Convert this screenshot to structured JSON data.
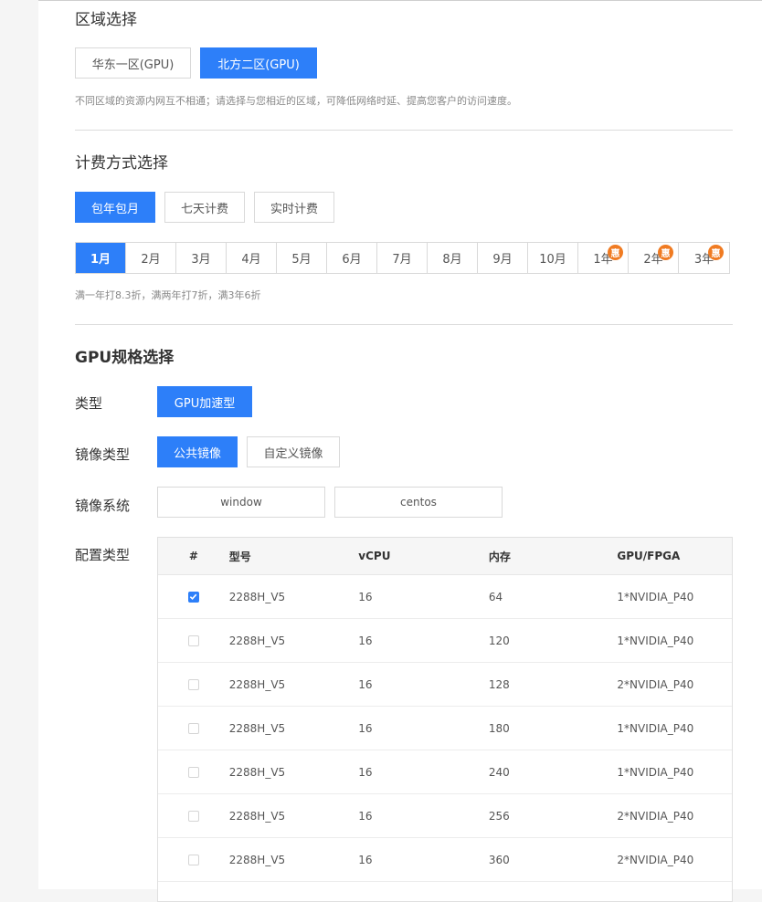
{
  "region": {
    "title": "区域选择",
    "options": [
      "华东一区(GPU)",
      "北方二区(GPU)"
    ],
    "selected": "北方二区(GPU)",
    "hint": "不同区域的资源内网互不相通；请选择与您相近的区域，可降低网络时延、提高您客户的访问速度。"
  },
  "billing": {
    "title": "计费方式选择",
    "options": [
      "包年包月",
      "七天计费",
      "实时计费"
    ],
    "selected": "包年包月",
    "months": [
      "1月",
      "2月",
      "3月",
      "4月",
      "5月",
      "6月",
      "7月",
      "8月",
      "9月",
      "10月",
      "1年",
      "2年",
      "3年"
    ],
    "selected_month": "1月",
    "promo_badge": "惠",
    "hint": "满一年打8.3折，满两年打7折，满3年6折"
  },
  "gpu": {
    "title": "GPU规格选择",
    "type_label": "类型",
    "type_options": [
      "GPU加速型"
    ],
    "image_type_label": "镜像类型",
    "image_type_options": [
      "公共镜像",
      "自定义镜像"
    ],
    "image_type_selected": "公共镜像",
    "image_system_label": "镜像系统",
    "image_system_options": [
      "window",
      "centos"
    ],
    "config_label": "配置类型",
    "table": {
      "headers": [
        "#",
        "型号",
        "vCPU",
        "内存",
        "GPU/FPGA"
      ],
      "rows": [
        {
          "checked": true,
          "model": "2288H_V5",
          "vcpu": "16",
          "mem": "64",
          "gpu": "1*NVIDIA_P40"
        },
        {
          "checked": false,
          "model": "2288H_V5",
          "vcpu": "16",
          "mem": "120",
          "gpu": "1*NVIDIA_P40"
        },
        {
          "checked": false,
          "model": "2288H_V5",
          "vcpu": "16",
          "mem": "128",
          "gpu": "2*NVIDIA_P40"
        },
        {
          "checked": false,
          "model": "2288H_V5",
          "vcpu": "16",
          "mem": "180",
          "gpu": "1*NVIDIA_P40"
        },
        {
          "checked": false,
          "model": "2288H_V5",
          "vcpu": "16",
          "mem": "240",
          "gpu": "1*NVIDIA_P40"
        },
        {
          "checked": false,
          "model": "2288H_V5",
          "vcpu": "16",
          "mem": "256",
          "gpu": "2*NVIDIA_P40"
        },
        {
          "checked": false,
          "model": "2288H_V5",
          "vcpu": "16",
          "mem": "360",
          "gpu": "2*NVIDIA_P40"
        }
      ]
    }
  },
  "colors": {
    "accent": "#2d7ff9",
    "promo": "#f07b22"
  }
}
